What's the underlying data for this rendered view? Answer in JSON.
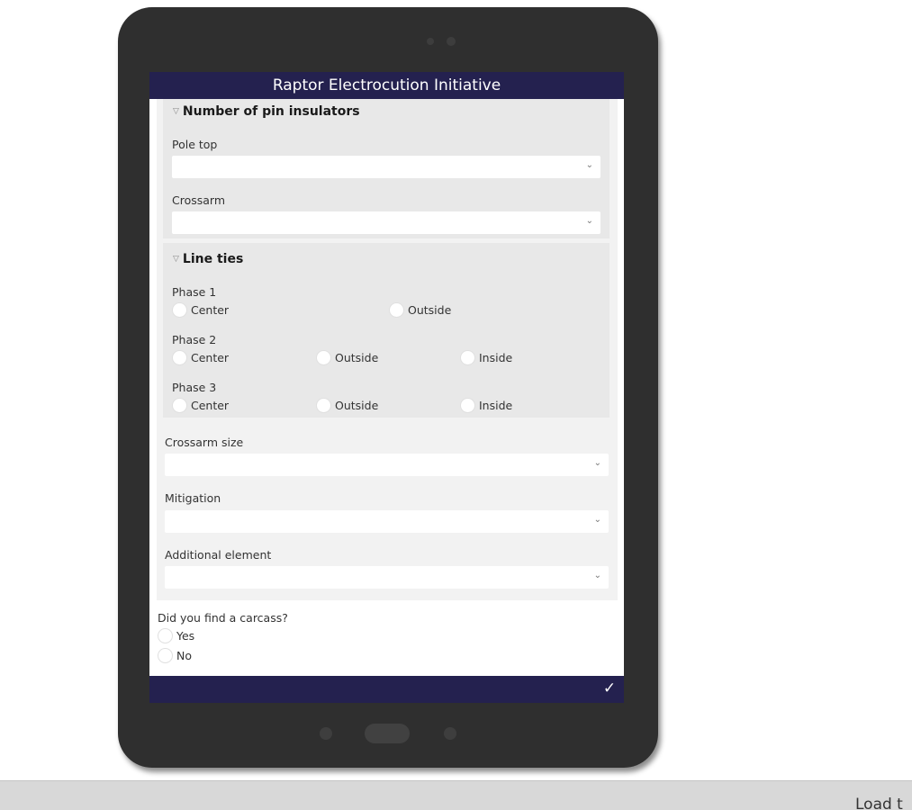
{
  "form": {
    "title": "Raptor Electrocution Initiative",
    "pin_insulators": {
      "title": "Number of pin insulators",
      "pole_top_label": "Pole top",
      "pole_top_value": "",
      "crossarm_label": "Crossarm",
      "crossarm_value": ""
    },
    "line_ties": {
      "title": "Line ties",
      "phase1": {
        "label": "Phase 1",
        "options": [
          "Center",
          "Outside"
        ]
      },
      "phase2": {
        "label": "Phase 2",
        "options": [
          "Center",
          "Outside",
          "Inside"
        ]
      },
      "phase3": {
        "label": "Phase 3",
        "options": [
          "Center",
          "Outside",
          "Inside"
        ]
      }
    },
    "crossarm_size": {
      "label": "Crossarm size",
      "value": ""
    },
    "mitigation": {
      "label": "Mitigation",
      "value": ""
    },
    "additional_element": {
      "label": "Additional element",
      "value": ""
    },
    "carcass": {
      "question": "Did you find a carcass?",
      "options": [
        "Yes",
        "No"
      ]
    }
  },
  "icons": {
    "collapse": "triangle-down-icon",
    "dropdown": "chevron-down-icon",
    "submit": "checkmark-icon"
  },
  "colors": {
    "header": "#24214f",
    "device": "#2f2f2f"
  },
  "status": {
    "text": "Load t"
  }
}
